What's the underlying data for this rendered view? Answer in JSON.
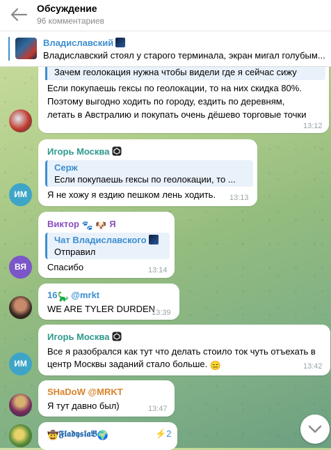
{
  "header": {
    "title": "Обсуждение",
    "subtitle": "96 комментариев"
  },
  "pinned": {
    "name": "Владиславский",
    "text": "Владиславский стоял у старого терминала, экран мигал голубым..."
  },
  "messages": [
    {
      "quote_text": "Зачем геолокация нужна чтобы видели где я сейчас сижу",
      "lines": [
        "Если покупаешь гексы по геолокации, то на них скидка 80%.",
        "Поэтому выгодно ходить по городу, ездить по деревням,",
        "летать в Австралию и покупать очень дёшево торговые точки"
      ],
      "time": "13:12"
    },
    {
      "sender": "Игорь Москва",
      "quote_name": "Серж",
      "quote_text": "Если покупаешь гексы по геолокации, то ...",
      "text": "Я не хожу я ездию пешком лень ходить.",
      "time": "13:13",
      "avatar": "ИМ"
    },
    {
      "sender": "Виктор",
      "sender_suffix": "Я",
      "quote_name": "Чат Владиславского",
      "quote_text": "Отправил",
      "text": "Спасибо",
      "time": "13:14",
      "avatar": "ВЯ"
    },
    {
      "sender": "16",
      "sender_suffix": "@mrkt",
      "text": "WE ARE TYLER DURDEN",
      "time": "13:39"
    },
    {
      "sender": "Игорь Москва",
      "lines": [
        "Все я разобрался как тут что делать стоило ток чуть отъехать в",
        "центр Москвы заданий стало больше."
      ],
      "time": "13:42",
      "avatar": "ИМ"
    },
    {
      "sender": "SHaDoW @MRKT",
      "text": "Я тут давно был)",
      "time": "13:47"
    },
    {
      "sender": "𝕱𝖑𝖆𝖉𝖞𝖘𝖑𝖆𝕭",
      "badge": "2"
    }
  ],
  "colors": {
    "accent": "#3d8fd0",
    "igor": "#2e9a8c",
    "viktor": "#8b4fbf",
    "shadow": "#d9822b",
    "avatar_im": "#3fa5c8",
    "avatar_vya": "#7b56c9"
  },
  "icons": [
    "back-arrow-icon",
    "chevron-down-icon",
    "dino-emoji",
    "paw-emoji",
    "dog-emoji",
    "badge-icon",
    "emoji-face"
  ]
}
